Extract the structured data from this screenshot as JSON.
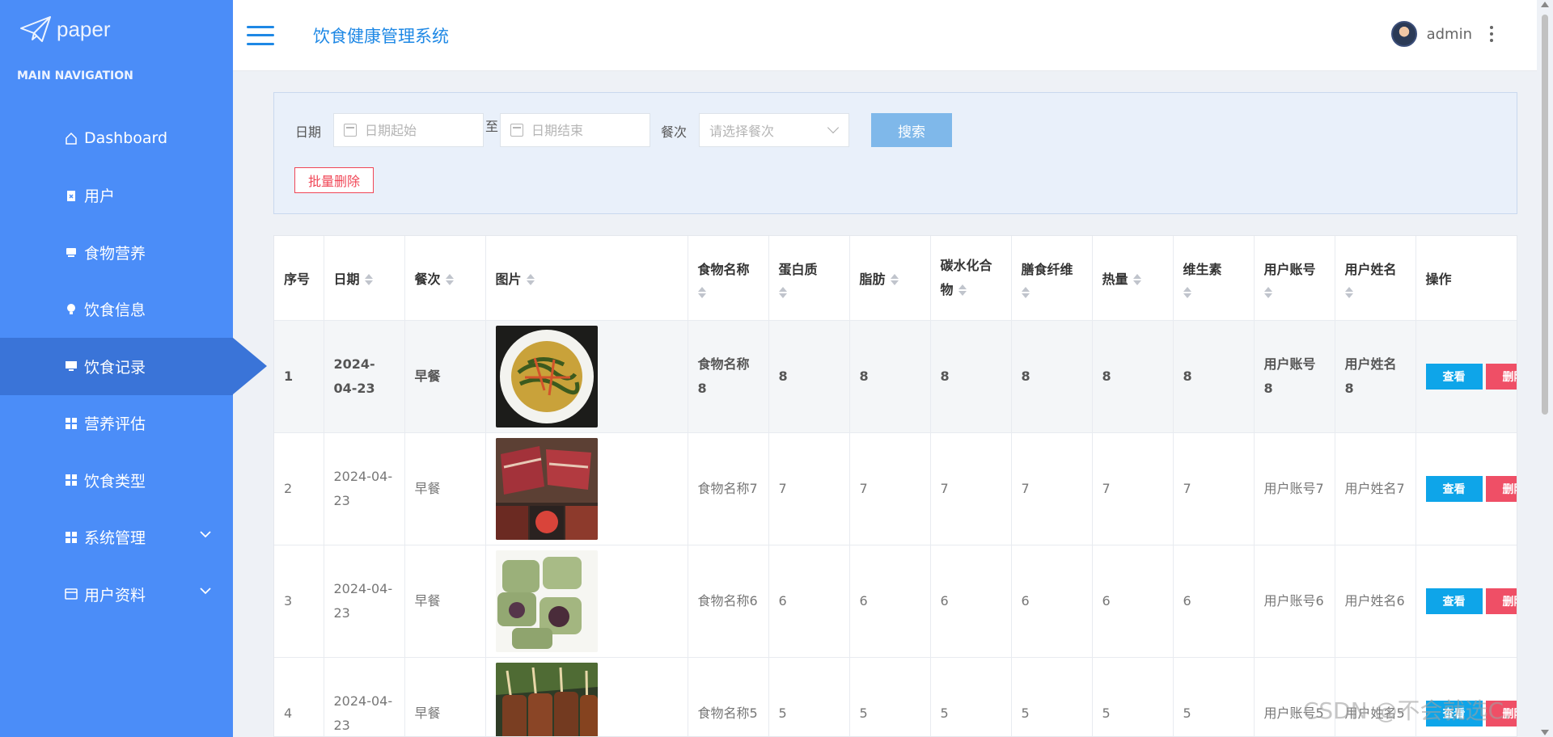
{
  "brand": {
    "name": "paper"
  },
  "sidebar": {
    "section_title": "MAIN NAVIGATION",
    "items": [
      {
        "label": "Dashboard",
        "icon": "home-icon"
      },
      {
        "label": "用户",
        "icon": "id-card-icon"
      },
      {
        "label": "食物营养",
        "icon": "monitor-icon"
      },
      {
        "label": "饮食信息",
        "icon": "lightbulb-icon"
      },
      {
        "label": "饮食记录",
        "icon": "desktop-icon",
        "active": true
      },
      {
        "label": "营养评估",
        "icon": "grid-icon"
      },
      {
        "label": "饮食类型",
        "icon": "grid-icon"
      },
      {
        "label": "系统管理",
        "icon": "grid-icon",
        "expandable": true
      },
      {
        "label": "用户资料",
        "icon": "card-icon",
        "expandable": true
      }
    ]
  },
  "header": {
    "title": "饮食健康管理系统",
    "username": "admin"
  },
  "filter": {
    "date_label": "日期",
    "date_start_placeholder": "日期起始",
    "date_to": "至",
    "date_end_placeholder": "日期结束",
    "meal_label": "餐次",
    "meal_placeholder": "请选择餐次",
    "search_label": "搜索",
    "batch_delete_label": "批量删除"
  },
  "table": {
    "columns": {
      "index": "序号",
      "date": "日期",
      "meal": "餐次",
      "image": "图片",
      "food_name": "食物名称",
      "protein": "蛋白质",
      "fat": "脂肪",
      "carbs": "碳水化合物",
      "fiber": "膳食纤维",
      "calories": "热量",
      "vitamin": "维生素",
      "user_account": "用户账号",
      "user_name": "用户姓名",
      "actions": "操作"
    },
    "view_label": "查看",
    "delete_label": "删除",
    "rows": [
      {
        "index": "1",
        "date": "2024-04-23",
        "meal": "早餐",
        "food_name": "食物名称8",
        "protein": "8",
        "fat": "8",
        "carbs": "8",
        "fiber": "8",
        "calories": "8",
        "vitamin": "8",
        "user_account": "用户账号8",
        "user_name": "用户姓名8"
      },
      {
        "index": "2",
        "date": "2024-04-23",
        "meal": "早餐",
        "food_name": "食物名称7",
        "protein": "7",
        "fat": "7",
        "carbs": "7",
        "fiber": "7",
        "calories": "7",
        "vitamin": "7",
        "user_account": "用户账号7",
        "user_name": "用户姓名7"
      },
      {
        "index": "3",
        "date": "2024-04-23",
        "meal": "早餐",
        "food_name": "食物名称6",
        "protein": "6",
        "fat": "6",
        "carbs": "6",
        "fiber": "6",
        "calories": "6",
        "vitamin": "6",
        "user_account": "用户账号6",
        "user_name": "用户姓名6"
      },
      {
        "index": "4",
        "date": "2024-04-23",
        "meal": "早餐",
        "food_name": "食物名称5",
        "protein": "5",
        "fat": "5",
        "carbs": "5",
        "fiber": "5",
        "calories": "5",
        "vitamin": "5",
        "user_account": "用户账号5",
        "user_name": "用户姓名5"
      }
    ]
  },
  "watermark": "CSDN @不会就选C.",
  "colors": {
    "sidebar": "#4b8df8",
    "sidebar_active": "#3a74d8",
    "accent": "#1e88e5",
    "view": "#0ea5e9",
    "danger": "#ef4f66"
  }
}
